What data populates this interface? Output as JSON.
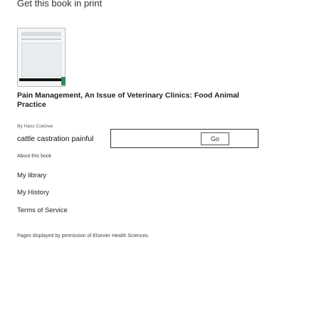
{
  "header": {
    "text": "Get this book in print"
  },
  "book": {
    "title": "Pain Management, An Issue of Veterinary Clinics: Food Animal Practice",
    "author": "By Hans Coetzee"
  },
  "search": {
    "value": "cattle castration painful",
    "button_label": "Go"
  },
  "links": {
    "about": "About this book",
    "my_library": "My library",
    "my_history": "My History",
    "terms": "Terms of Service"
  },
  "footer": {
    "permission": "Pages displayed by permission of Elsevier Health Sciences."
  }
}
